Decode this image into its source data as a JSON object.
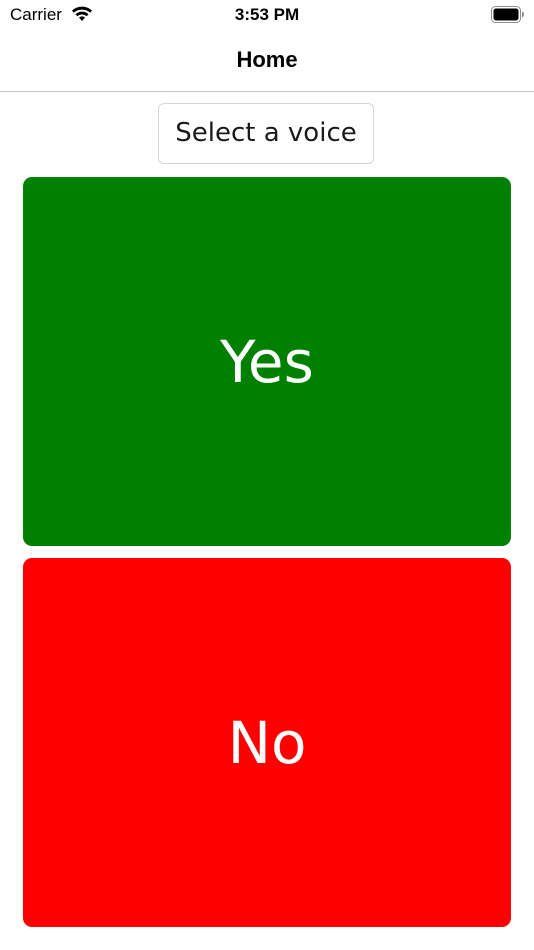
{
  "status_bar": {
    "carrier": "Carrier",
    "time": "3:53 PM",
    "wifi_icon": "wifi-icon",
    "battery_icon": "battery-icon"
  },
  "nav": {
    "title": "Home"
  },
  "voice_selector": {
    "placeholder": "Select a voice"
  },
  "buttons": {
    "yes": {
      "label": "Yes",
      "color": "#008000"
    },
    "no": {
      "label": "No",
      "color": "#ff0000"
    }
  },
  "colors": {
    "background": "#ffffff",
    "divider": "#c8c8cc"
  }
}
